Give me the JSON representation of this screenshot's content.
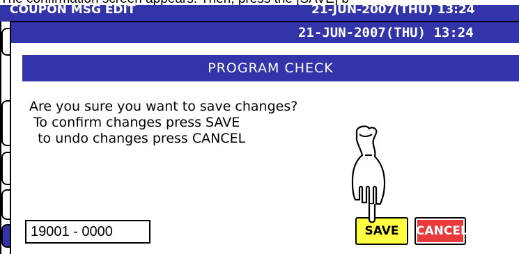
{
  "instruction": "The confirmation screen appears. Then, press the [SAVE] b",
  "background_window": {
    "title": "COUPON MSG EDIT",
    "datetime": "21-JUN-2007(THU) 13:24"
  },
  "dialog": {
    "datetime": "21-JUN-2007(THU) 13:24",
    "title": "PROGRAM CHECK",
    "message": [
      "Are you sure you want to save changes?",
      " To confirm changes press SAVE",
      "  to undo changes press CANCEL"
    ],
    "code_field": "19001 - 0000",
    "save_label": "SAVE",
    "cancel_label": "CANCEL"
  },
  "colors": {
    "header_blue": "#3333aa",
    "save_yellow": "#ffff44",
    "cancel_red": "#e83a3a"
  },
  "icons": {
    "pointer": "pointing-hand-icon"
  }
}
